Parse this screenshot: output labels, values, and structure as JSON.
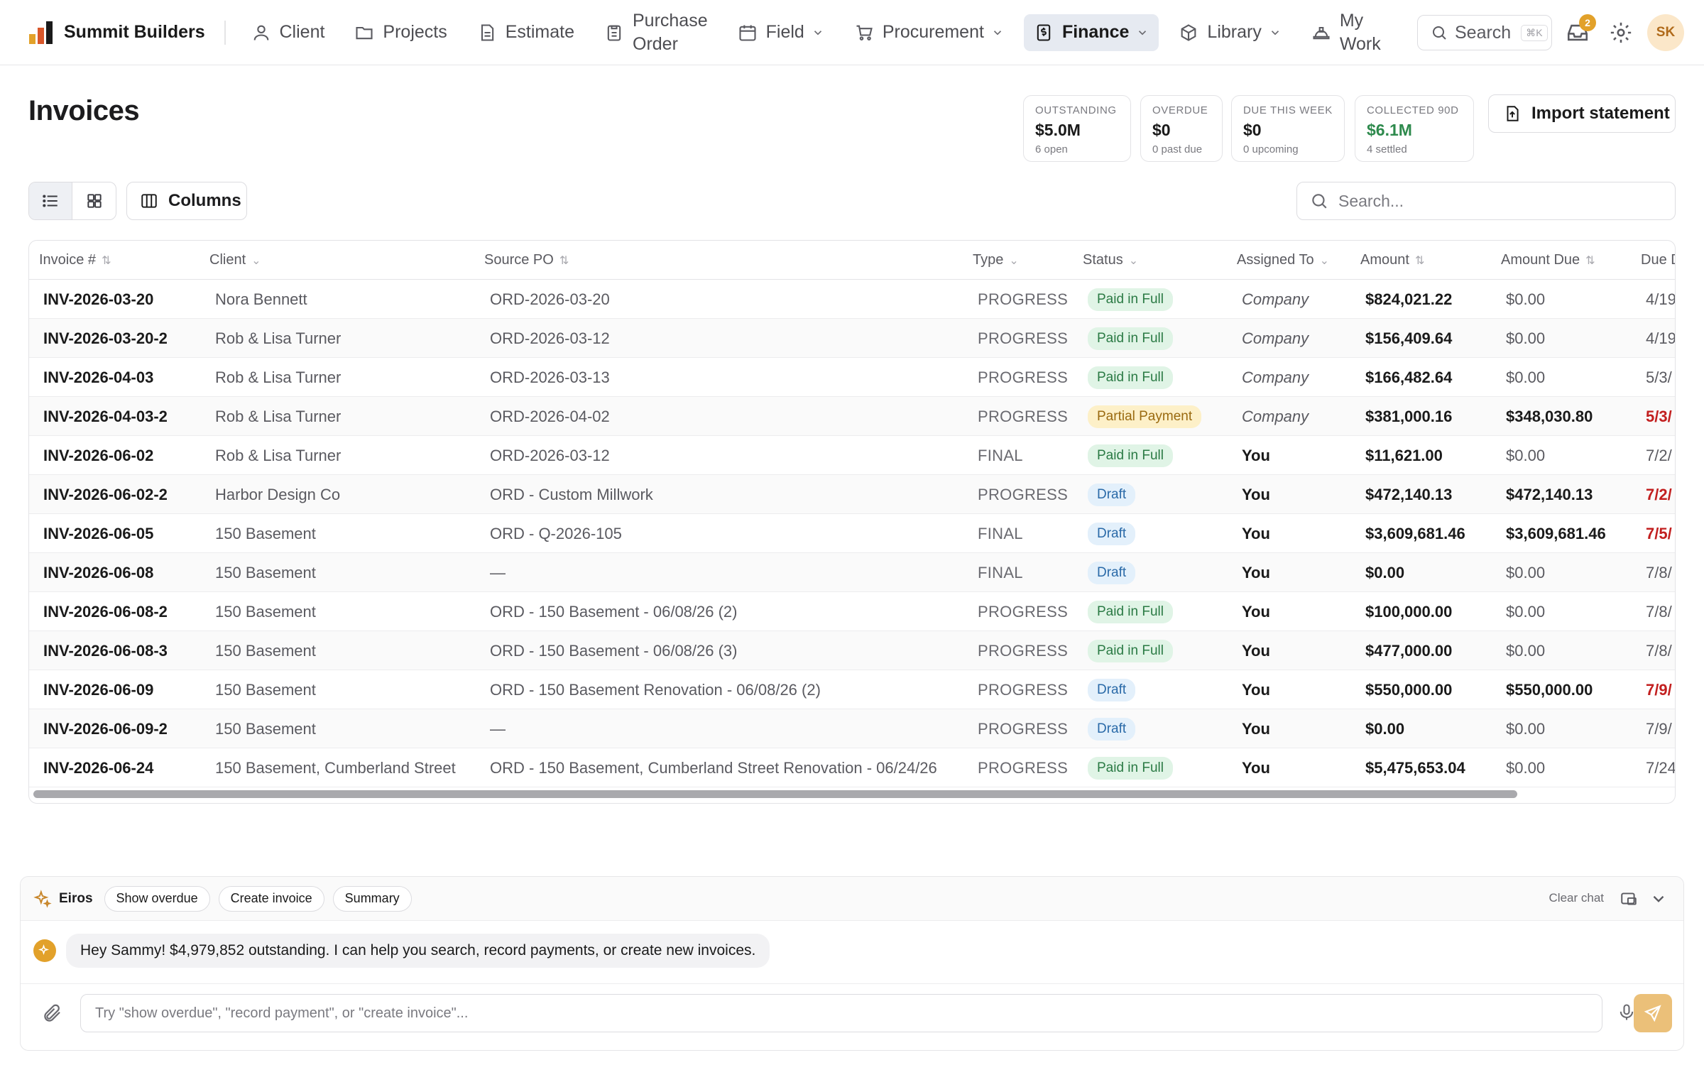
{
  "brand": {
    "name": "Summit Builders"
  },
  "nav": {
    "items": [
      {
        "label": "Client",
        "icon": "user-icon"
      },
      {
        "label": "Projects",
        "icon": "folder-icon"
      },
      {
        "label": "Estimate",
        "icon": "document-icon"
      },
      {
        "label": "Purchase Order",
        "line1": "Purchase",
        "line2": "Order",
        "icon": "clipboard-icon"
      },
      {
        "label": "Field",
        "icon": "calendar-icon",
        "dropdown": true
      },
      {
        "label": "Procurement",
        "icon": "cart-icon",
        "dropdown": true
      },
      {
        "label": "Finance",
        "icon": "dollar-file-icon",
        "dropdown": true,
        "active": true
      },
      {
        "label": "Library",
        "icon": "cube-icon",
        "dropdown": true
      },
      {
        "label": "My Work",
        "line1": "My",
        "line2": "Work",
        "icon": "hard-hat-icon"
      }
    ],
    "search_label": "Search",
    "search_shortcut": "⌘K",
    "notification_count": "2",
    "avatar_initials": "SK"
  },
  "page": {
    "title": "Invoices"
  },
  "stats": [
    {
      "label": "OUTSTANDING",
      "value": "$5.0M",
      "sub": "6 open"
    },
    {
      "label": "OVERDUE",
      "value": "$0",
      "sub": "0 past due"
    },
    {
      "label": "DUE THIS WEEK",
      "value": "$0",
      "sub": "0 upcoming"
    },
    {
      "label": "COLLECTED 90D",
      "value": "$6.1M",
      "sub": "4 settled",
      "color": "#2e8a4d"
    }
  ],
  "import_label": "Import statement",
  "toolbar": {
    "columns_label": "Columns",
    "search_placeholder": "Search..."
  },
  "table": {
    "columns": [
      "Invoice #",
      "Client",
      "Source PO",
      "Type",
      "Status",
      "Assigned To",
      "Amount",
      "Amount Due",
      "Due D"
    ],
    "rows": [
      {
        "invoice": "INV-2026-03-20",
        "client": "Nora Bennett",
        "po": "ORD-2026-03-20",
        "type": "PROGRESS",
        "status": "Paid in Full",
        "assigned": "Company",
        "amount": "$824,021.22",
        "due_amount": "$0.00",
        "due_date": "4/19"
      },
      {
        "invoice": "INV-2026-03-20-2",
        "client": "Rob & Lisa Turner",
        "po": "ORD-2026-03-12",
        "type": "PROGRESS",
        "status": "Paid in Full",
        "assigned": "Company",
        "amount": "$156,409.64",
        "due_amount": "$0.00",
        "due_date": "4/19"
      },
      {
        "invoice": "INV-2026-04-03",
        "client": "Rob & Lisa Turner",
        "po": "ORD-2026-03-13",
        "type": "PROGRESS",
        "status": "Paid in Full",
        "assigned": "Company",
        "amount": "$166,482.64",
        "due_amount": "$0.00",
        "due_date": "5/3/"
      },
      {
        "invoice": "INV-2026-04-03-2",
        "client": "Rob & Lisa Turner",
        "po": "ORD-2026-04-02",
        "type": "PROGRESS",
        "status": "Partial Payment",
        "assigned": "Company",
        "amount": "$381,000.16",
        "due_amount": "$348,030.80",
        "due_date": "5/3/"
      },
      {
        "invoice": "INV-2026-06-02",
        "client": "Rob & Lisa Turner",
        "po": "ORD-2026-03-12",
        "type": "FINAL",
        "status": "Paid in Full",
        "assigned": "You",
        "amount": "$11,621.00",
        "due_amount": "$0.00",
        "due_date": "7/2/"
      },
      {
        "invoice": "INV-2026-06-02-2",
        "client": "Harbor Design Co",
        "po": "ORD - Custom Millwork",
        "type": "PROGRESS",
        "status": "Draft",
        "assigned": "You",
        "amount": "$472,140.13",
        "due_amount": "$472,140.13",
        "due_date": "7/2/"
      },
      {
        "invoice": "INV-2026-06-05",
        "client": "150 Basement",
        "po": "ORD - Q-2026-105",
        "type": "FINAL",
        "status": "Draft",
        "assigned": "You",
        "amount": "$3,609,681.46",
        "due_amount": "$3,609,681.46",
        "due_date": "7/5/"
      },
      {
        "invoice": "INV-2026-06-08",
        "client": "150 Basement",
        "po": "—",
        "type": "FINAL",
        "status": "Draft",
        "assigned": "You",
        "amount": "$0.00",
        "due_amount": "$0.00",
        "due_date": "7/8/"
      },
      {
        "invoice": "INV-2026-06-08-2",
        "client": "150 Basement",
        "po": "ORD - 150 Basement - 06/08/26 (2)",
        "type": "PROGRESS",
        "status": "Paid in Full",
        "assigned": "You",
        "amount": "$100,000.00",
        "due_amount": "$0.00",
        "due_date": "7/8/"
      },
      {
        "invoice": "INV-2026-06-08-3",
        "client": "150 Basement",
        "po": "ORD - 150 Basement - 06/08/26 (3)",
        "type": "PROGRESS",
        "status": "Paid in Full",
        "assigned": "You",
        "amount": "$477,000.00",
        "due_amount": "$0.00",
        "due_date": "7/8/"
      },
      {
        "invoice": "INV-2026-06-09",
        "client": "150 Basement",
        "po": "ORD - 150 Basement Renovation - 06/08/26 (2)",
        "type": "PROGRESS",
        "status": "Draft",
        "assigned": "You",
        "amount": "$550,000.00",
        "due_amount": "$550,000.00",
        "due_date": "7/9/"
      },
      {
        "invoice": "INV-2026-06-09-2",
        "client": "150 Basement",
        "po": "—",
        "type": "PROGRESS",
        "status": "Draft",
        "assigned": "You",
        "amount": "$0.00",
        "due_amount": "$0.00",
        "due_date": "7/9/"
      },
      {
        "invoice": "INV-2026-06-24",
        "client": "150 Basement, Cumberland Street",
        "po": "ORD - 150 Basement, Cumberland Street Renovation - 06/24/26",
        "type": "PROGRESS",
        "status": "Paid in Full",
        "assigned": "You",
        "amount": "$5,475,653.04",
        "due_amount": "$0.00",
        "due_date": "7/24"
      }
    ]
  },
  "chat": {
    "assistant_name": "Eiros",
    "chips": [
      "Show overdue",
      "Create invoice",
      "Summary"
    ],
    "clear_label": "Clear chat",
    "message": "Hey Sammy! $4,979,852 outstanding. I can help you search, record payments, or create new invoices.",
    "input_placeholder": "Try \"show overdue\", \"record payment\", or \"create invoice\"..."
  },
  "colors": {
    "accent": "#e2a12a",
    "paid": "#2a7a44",
    "partial": "#9a6a10",
    "draft": "#2a6aa8",
    "overdue": "#c21f1f",
    "active_nav": "#e6eaf1"
  }
}
